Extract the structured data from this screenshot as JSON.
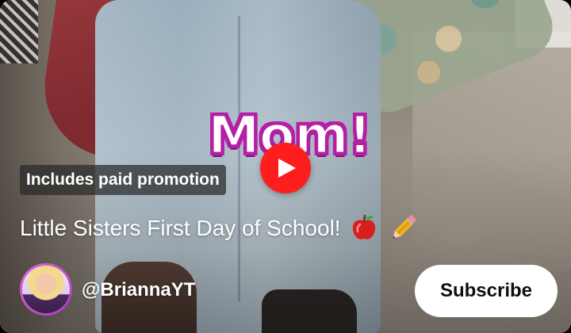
{
  "overlay": {
    "sticker_text": "Mom!",
    "paid_promotion_label": "Includes paid promotion"
  },
  "player": {
    "play_icon": "play-icon",
    "accent_color": "#ff1e1e"
  },
  "video": {
    "title": "Little Sisters First Day of School!",
    "title_emojis": [
      "apple-icon",
      "pencil-icon"
    ]
  },
  "channel": {
    "handle": "@BriannaYT",
    "avatar_icon": "channel-avatar",
    "subscribe_label": "Subscribe"
  },
  "colors": {
    "sticker_outline": "#b51fa5",
    "subscribe_bg": "#ffffff",
    "subscribe_text": "#0f0f0f"
  }
}
